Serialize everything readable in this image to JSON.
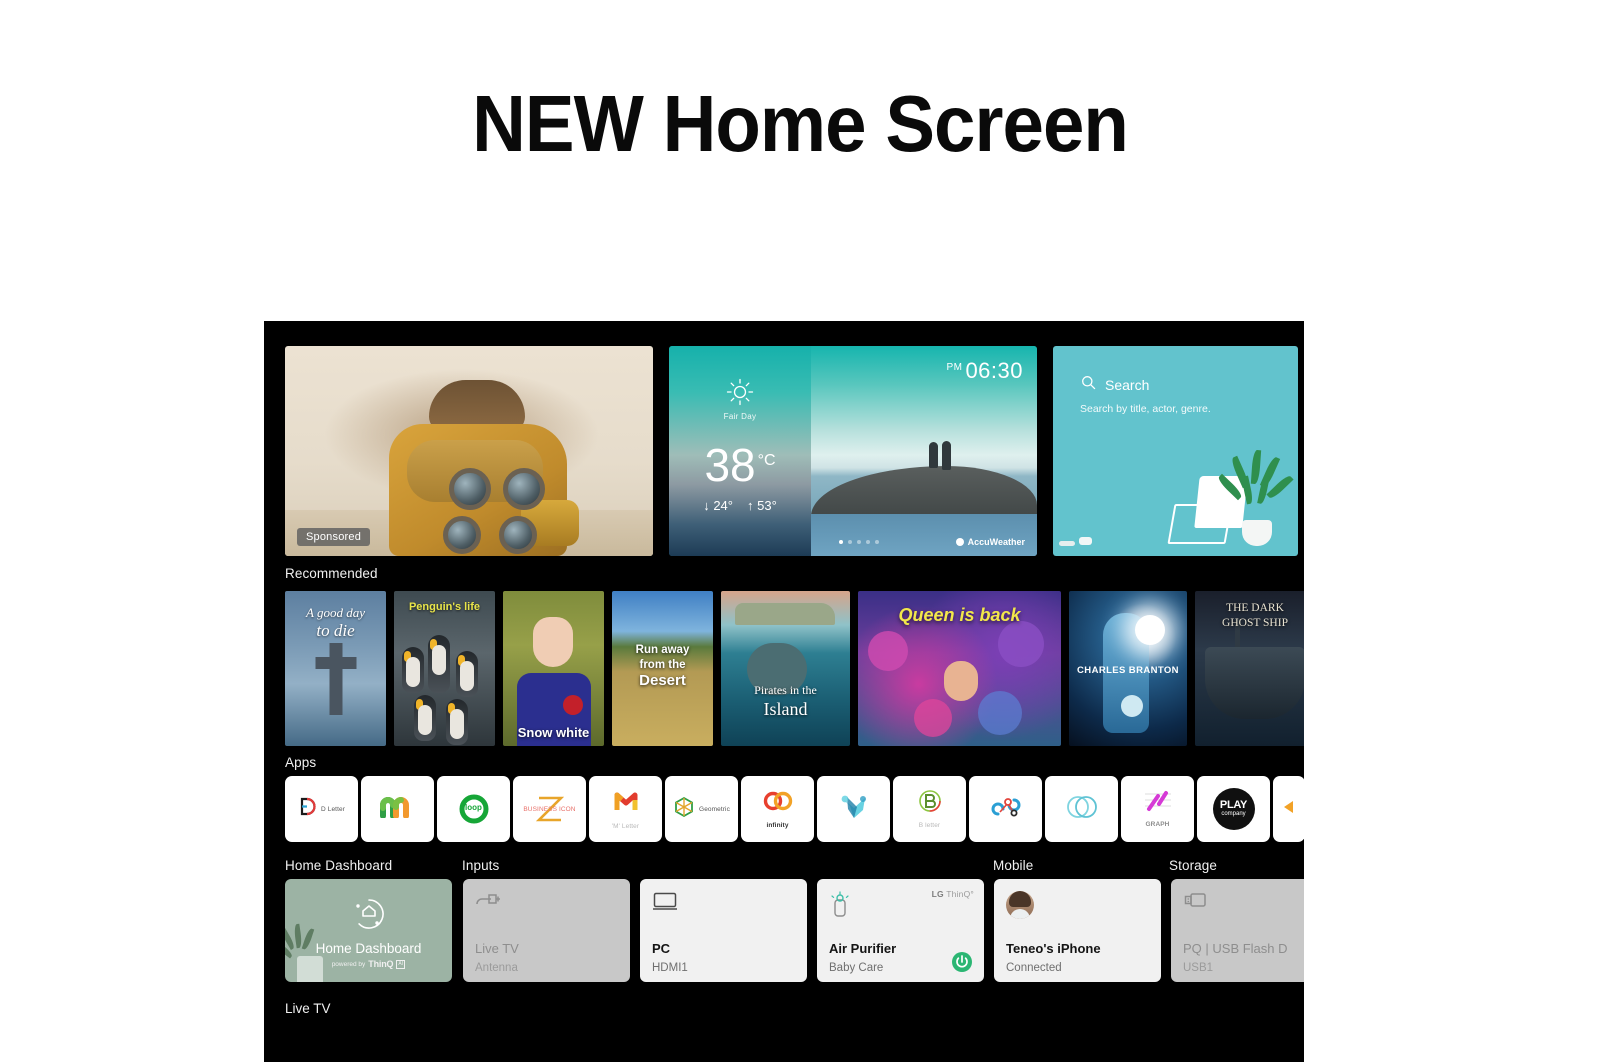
{
  "headline": "NEW Home Screen",
  "hero": {
    "sponsored": {
      "badge": "Sponsored",
      "name": "sponsored-ad-card"
    },
    "weather": {
      "condition": "Fair Day",
      "temperature": "38",
      "unit": "°C",
      "low": "↓ 24°",
      "high": "↑ 53°",
      "time": "06:30",
      "ampm": "PM",
      "provider": "AccuWeather",
      "dots": 5,
      "active_dot": 0
    },
    "search": {
      "title": "Search",
      "subtitle": "Search by title, actor, genre.",
      "icon": "search-icon"
    }
  },
  "recommended": {
    "label": "Recommended",
    "items": [
      {
        "line1": "A good day",
        "line2": "to die"
      },
      {
        "line1": "Penguin's life",
        "line2": ""
      },
      {
        "line1": "Snow white",
        "line2": ""
      },
      {
        "line1": "Run away",
        "line2": "from the",
        "line3": "Desert"
      },
      {
        "line1": "Pirates in the",
        "line2": "Island"
      },
      {
        "line1": "Queen is back",
        "line2": ""
      },
      {
        "line1": "CHARLES BRANTON",
        "line2": ""
      },
      {
        "line1": "THE DARK",
        "line2": "GHOST SHIP"
      }
    ]
  },
  "apps": {
    "label": "Apps",
    "items": [
      {
        "name": "D Letter",
        "icon": "d-letter-icon"
      },
      {
        "name": "",
        "icon": "m-arch-icon"
      },
      {
        "name": "loop",
        "icon": "loop-icon"
      },
      {
        "name": "BUSINESS ICON",
        "icon": "z-business-icon"
      },
      {
        "name": "'M' Letter",
        "icon": "m-letter-icon"
      },
      {
        "name": "Geometric",
        "icon": "geometric-cube-icon"
      },
      {
        "name": "infinity",
        "icon": "infinity-rings-icon"
      },
      {
        "name": "",
        "icon": "bird-origami-icon"
      },
      {
        "name": "B letter",
        "icon": "b-letter-icon"
      },
      {
        "name": "",
        "icon": "molecule-icon"
      },
      {
        "name": "",
        "icon": "double-circle-icon"
      },
      {
        "name": "GRAPH",
        "icon": "graph-icon"
      },
      {
        "name": "PLAY company",
        "icon": "play-company-icon"
      },
      {
        "name": "",
        "icon": "partial-app-icon"
      }
    ]
  },
  "dashboard": {
    "groups": [
      {
        "label": "Home Dashboard"
      },
      {
        "label": "Inputs"
      },
      {
        "label": "Mobile"
      },
      {
        "label": "Storage"
      }
    ],
    "home_tile": {
      "title": "Home Dashboard",
      "powered_by": "powered by",
      "brand": "ThinQ",
      "badge": "AI",
      "icon": "home-dashboard-icon"
    },
    "tiles": [
      {
        "title": "Live TV",
        "subtitle": "Antenna",
        "icon": "antenna-icon",
        "state": "dim"
      },
      {
        "title": "PC",
        "subtitle": "HDMI1",
        "icon": "monitor-icon",
        "state": "lite"
      },
      {
        "title": "Air Purifier",
        "subtitle": "Baby Care",
        "icon": "air-purifier-icon",
        "state": "lite",
        "brand": "LG",
        "brand2": "ThinQ",
        "power": "power-icon"
      },
      {
        "title": "Teneo's iPhone",
        "subtitle": "Connected",
        "icon": "avatar-icon",
        "state": "lite"
      },
      {
        "title": "PQ | USB Flash D",
        "subtitle": "USB1",
        "icon": "usb-icon",
        "state": "dim"
      }
    ]
  },
  "live_tv": {
    "label": "Live TV"
  },
  "colors": {
    "panel_bg": "#000000",
    "search_card": "#62c3cd",
    "home_tile": "#9cb3a4",
    "power_green": "#2bb673",
    "text_light": "#f0f0f0"
  }
}
